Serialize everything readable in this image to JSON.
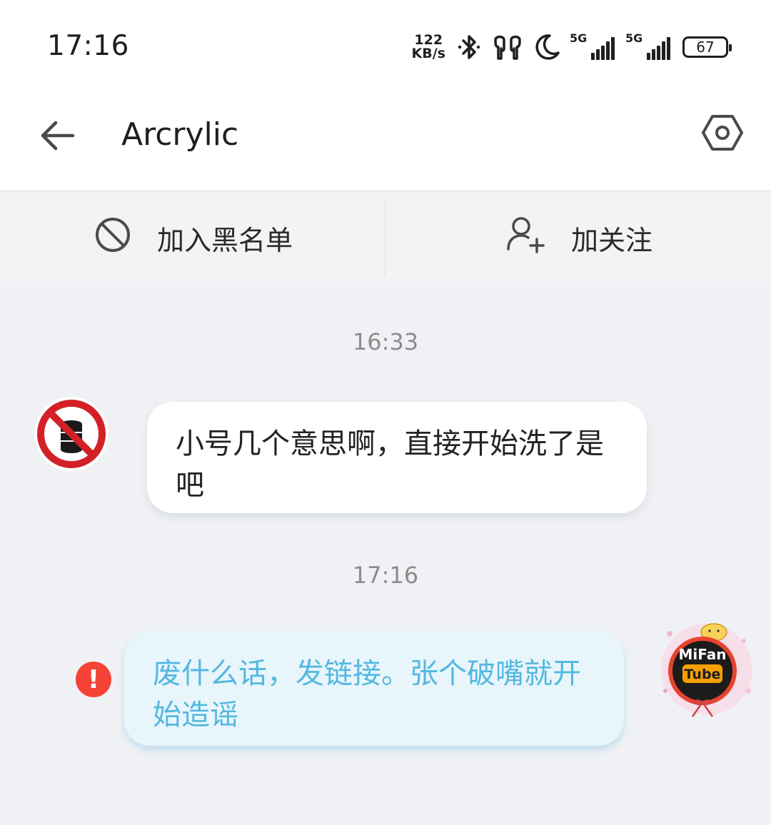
{
  "status_bar": {
    "time": "17:16",
    "net_speed_value": "122",
    "net_speed_unit": "KB/s",
    "signal1_label": "5G",
    "signal2_label": "5G",
    "battery": "67",
    "icons": [
      "bluetooth-icon",
      "earbuds-icon",
      "moon-icon",
      "signal-icon",
      "signal-icon",
      "battery-icon"
    ]
  },
  "header": {
    "title": "Arcrylic",
    "icons": [
      "back-arrow-icon",
      "settings-hexagon-icon"
    ]
  },
  "actions": {
    "block_label": "加入黑名单",
    "follow_label": "加关注"
  },
  "chat": {
    "messages": [
      {
        "timestamp": "16:33",
        "direction": "incoming",
        "text": "小号几个意思啊，直接开始洗了是吧"
      },
      {
        "timestamp": "17:16",
        "direction": "outgoing",
        "status": "failed",
        "text": "废什么话，发链接。张个破嘴就开始造谣"
      }
    ],
    "avatar_right_text_line1": "MiFan",
    "avatar_right_text_line2": "Tube",
    "colors": {
      "outgoing_bubble": "#e8f6fc",
      "outgoing_text": "#53b8df",
      "error": "#f44336"
    }
  }
}
